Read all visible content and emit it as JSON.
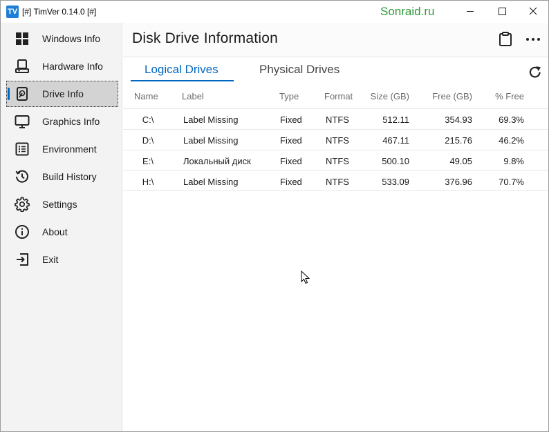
{
  "window": {
    "app_icon_text": "TV",
    "title": "[#] TimVer  0.14.0 [#]",
    "watermark": "Sonraid.ru",
    "controls": [
      "minimize-icon",
      "maximize-icon",
      "close-icon"
    ]
  },
  "sidebar": {
    "items": [
      {
        "label": "Windows Info",
        "icon": "windows-logo-icon",
        "active": false
      },
      {
        "label": "Hardware Info",
        "icon": "computer-icon",
        "active": false
      },
      {
        "label": "Drive Info",
        "icon": "hard-drive-icon",
        "active": true
      },
      {
        "label": "Graphics Info",
        "icon": "monitor-icon",
        "active": false
      },
      {
        "label": "Environment",
        "icon": "list-icon",
        "active": false
      },
      {
        "label": "Build History",
        "icon": "history-icon",
        "active": false
      },
      {
        "label": "Settings",
        "icon": "gear-icon",
        "active": false
      },
      {
        "label": "About",
        "icon": "info-icon",
        "active": false
      },
      {
        "label": "Exit",
        "icon": "exit-icon",
        "active": false
      }
    ]
  },
  "main": {
    "title": "Disk Drive Information",
    "header_icons": [
      "clipboard-icon",
      "more-icon"
    ],
    "tabs": [
      {
        "label": "Logical Drives",
        "selected": true
      },
      {
        "label": "Physical Drives",
        "selected": false
      }
    ],
    "refresh_icon": "refresh-icon",
    "table": {
      "columns": [
        "Name",
        "Label",
        "Type",
        "Format",
        "Size (GB)",
        "Free (GB)",
        "% Free"
      ],
      "rows": [
        {
          "name": "C:\\",
          "label": "Label Missing",
          "type": "Fixed",
          "format": "NTFS",
          "size": "512.11",
          "free": "354.93",
          "pct": "69.3%"
        },
        {
          "name": "D:\\",
          "label": "Label Missing",
          "type": "Fixed",
          "format": "NTFS",
          "size": "467.11",
          "free": "215.76",
          "pct": "46.2%"
        },
        {
          "name": "E:\\",
          "label": "Локальный диск",
          "type": "Fixed",
          "format": "NTFS",
          "size": "500.10",
          "free": "49.05",
          "pct": "9.8%"
        },
        {
          "name": "H:\\",
          "label": "Label Missing",
          "type": "Fixed",
          "format": "NTFS",
          "size": "533.09",
          "free": "376.96",
          "pct": "70.7%"
        }
      ]
    }
  },
  "colors": {
    "accent": "#0067c0",
    "watermark": "#2e9b3a",
    "sidebar_bg": "#f3f3f3",
    "active_item_bg": "#d3d3d3"
  }
}
